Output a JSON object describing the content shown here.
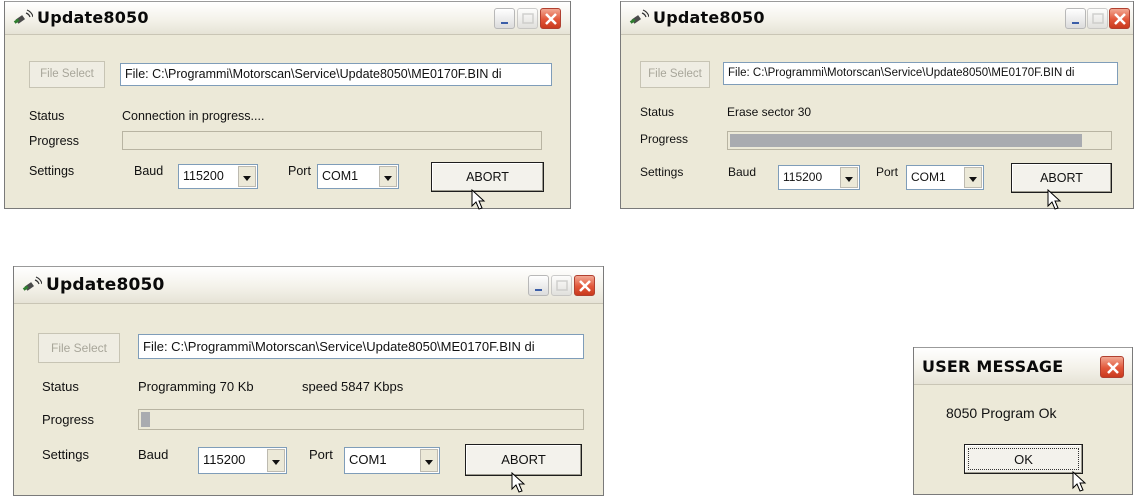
{
  "windows": [
    {
      "title": "Update8050",
      "file_select_label": "File Select",
      "file_path": "File: C:\\Programmi\\Motorscan\\Service\\Update8050\\ME0170F.BIN di",
      "status_label": "Status",
      "status_text": "Connection in progress....",
      "progress_label": "Progress",
      "progress_value": 0,
      "settings_label": "Settings",
      "baud_label": "Baud",
      "baud_value": "115200",
      "port_label": "Port",
      "port_value": "COM1",
      "abort_label": "ABORT"
    },
    {
      "title": "Update8050",
      "file_select_label": "File Select",
      "file_path": "File: C:\\Programmi\\Motorscan\\Service\\Update8050\\ME0170F.BIN di",
      "status_label": "Status",
      "status_text": "Erase sector 30",
      "progress_label": "Progress",
      "progress_value": 0.93,
      "settings_label": "Settings",
      "baud_label": "Baud",
      "baud_value": "115200",
      "port_label": "Port",
      "port_value": "COM1",
      "abort_label": "ABORT"
    },
    {
      "title": "Update8050",
      "file_select_label": "File Select",
      "file_path": "File: C:\\Programmi\\Motorscan\\Service\\Update8050\\ME0170F.BIN di",
      "status_label": "Status",
      "status_text": "Programming  70 Kb",
      "status_speed": "speed 5847 Kbps",
      "progress_label": "Progress",
      "progress_value": 0.02,
      "settings_label": "Settings",
      "baud_label": "Baud",
      "baud_value": "115200",
      "port_label": "Port",
      "port_value": "COM1",
      "abort_label": "ABORT"
    }
  ],
  "message_box": {
    "title": "USER MESSAGE",
    "message": "8050 Program Ok",
    "ok_label": "OK"
  },
  "colors": {
    "window_bg": "#ece9d8",
    "close_button": "#e2573a",
    "progress_fill": "#a9abb0"
  },
  "icons": [
    "satellite-icon",
    "minimize-icon",
    "maximize-icon",
    "close-icon",
    "dropdown-arrow-icon",
    "mouse-cursor-icon"
  ]
}
